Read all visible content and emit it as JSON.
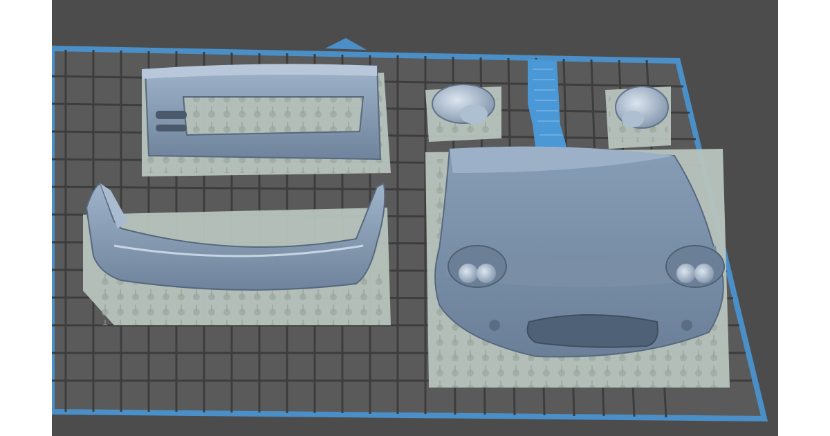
{
  "viewer": {
    "background_color": "#4c4c4c",
    "build_plate_color": "#5a5a5a",
    "grid_color": "#3a3a3a",
    "plate_border_color": "#4a8fc7",
    "model_color": "#8fa5bd",
    "support_raft_color": "#b7c4bd",
    "slice_label_color": "#4a98d6"
  },
  "models": [
    {
      "name": "upper-grille-frame"
    },
    {
      "name": "front-bumper-lip"
    },
    {
      "name": "headlight-left"
    },
    {
      "name": "headlight-right"
    },
    {
      "name": "hood-front-clip"
    },
    {
      "name": "label-tag"
    }
  ]
}
